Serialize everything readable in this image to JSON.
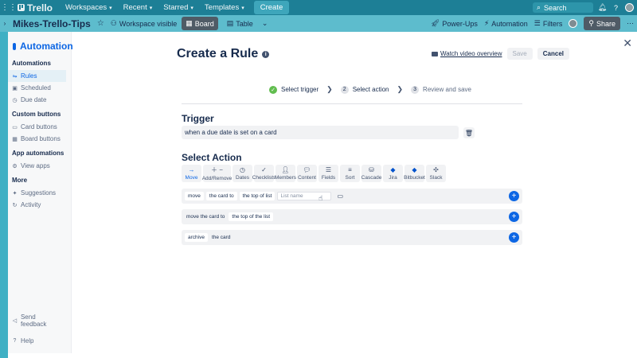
{
  "topnav": {
    "logo": "Trello",
    "menu": [
      {
        "label": "Workspaces"
      },
      {
        "label": "Recent"
      },
      {
        "label": "Starred"
      },
      {
        "label": "Templates"
      }
    ],
    "create_label": "Create",
    "search_placeholder": "Search"
  },
  "board": {
    "title": "Mikes-Trello-Tips",
    "visibility": "Workspace visible",
    "views": [
      {
        "label": "Board",
        "active": true
      },
      {
        "label": "Table",
        "active": false
      }
    ],
    "right": {
      "powerups": "Power-Ups",
      "automation": "Automation",
      "filters": "Filters",
      "share": "Share"
    }
  },
  "sidebar": {
    "title": "Automation",
    "sections": [
      {
        "heading": "Automations",
        "items": [
          "Rules",
          "Scheduled",
          "Due date"
        ]
      },
      {
        "heading": "Custom buttons",
        "items": [
          "Card buttons",
          "Board buttons"
        ]
      },
      {
        "heading": "App automations",
        "items": [
          "View apps"
        ]
      },
      {
        "heading": "More",
        "items": [
          "Suggestions",
          "Activity"
        ]
      }
    ],
    "footer": [
      "Send feedback",
      "Help"
    ]
  },
  "rule": {
    "title": "Create a Rule",
    "watch_label": "Watch video overview",
    "save_label": "Save",
    "cancel_label": "Cancel",
    "steps": [
      {
        "badge": "✓",
        "label": "Select trigger",
        "state": "done"
      },
      {
        "badge": "2",
        "label": "Select action",
        "state": "current"
      },
      {
        "badge": "3",
        "label": "Review and save",
        "state": "upcoming"
      }
    ],
    "trigger_heading": "Trigger",
    "trigger_text": "when a due date is set on a card",
    "action_heading": "Select Action",
    "action_tabs": [
      "Move",
      "Add/Remove",
      "Dates",
      "Checklists",
      "Members",
      "Content",
      "Fields",
      "Sort",
      "Cascade",
      "Jira",
      "Bitbucket",
      "Slack"
    ],
    "actions": {
      "row1": {
        "verb": "move",
        "object": "the card to",
        "position": "the top of list",
        "input_placeholder": "List name"
      },
      "row2": {
        "verb": "move the card to",
        "position": "the top of the list"
      },
      "row3": {
        "verb": "archive",
        "object": "the card"
      }
    }
  }
}
